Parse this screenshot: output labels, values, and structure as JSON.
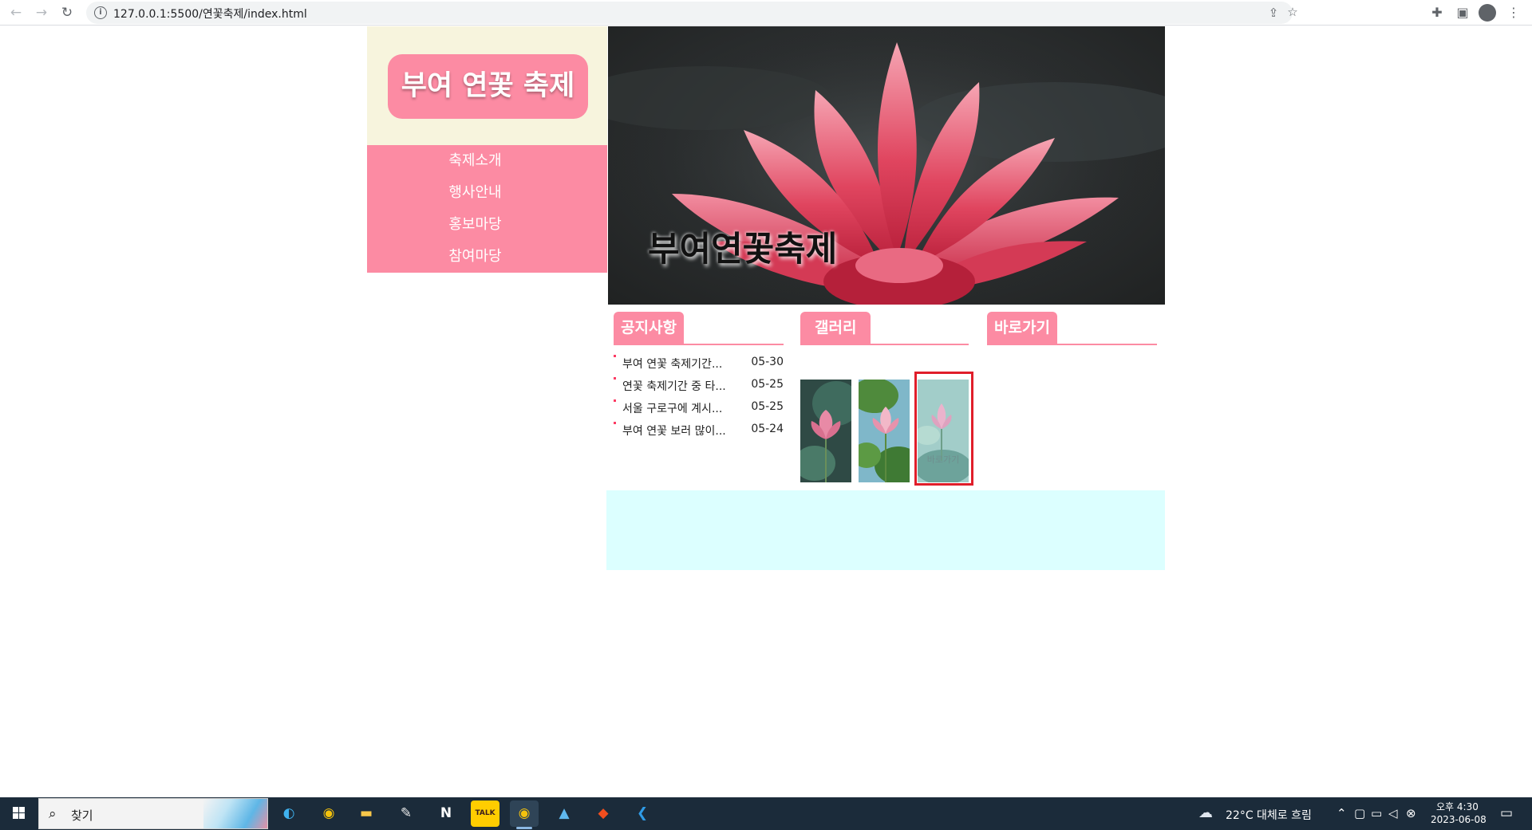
{
  "browser": {
    "url": "127.0.0.1:5500/연꽃축제/index.html"
  },
  "site": {
    "logo": "부여 연꽃 축제",
    "menu": [
      "축제소개",
      "행사안내",
      "홍보마당",
      "참여마당"
    ],
    "hero_caption": "부여연꽃축제",
    "notice": {
      "title": "공지사항",
      "items": [
        {
          "title": "부여 연꽃 축제기간...",
          "date": "05-30"
        },
        {
          "title": "연꽃 축제기간 중 타...",
          "date": "05-25"
        },
        {
          "title": "서울 구로구에 계시...",
          "date": "05-25"
        },
        {
          "title": "부여 연꽃 보러 많이...",
          "date": "05-24"
        }
      ]
    },
    "gallery": {
      "title": "갤러리",
      "hover_label": "바로가기"
    },
    "shortcut": {
      "title": "바로가기"
    }
  },
  "taskbar": {
    "search_label": "찾기",
    "weather": "22°C 대체로 흐림",
    "time": "오후 4:30",
    "date": "2023-06-08",
    "apps": [
      "edge-icon",
      "chrome-icon",
      "file-explorer-icon",
      "paint-icon",
      "notion-icon",
      "kakaotalk-icon",
      "chrome-profile-icon",
      "photos-icon",
      "figma-icon",
      "vscode-icon"
    ]
  }
}
